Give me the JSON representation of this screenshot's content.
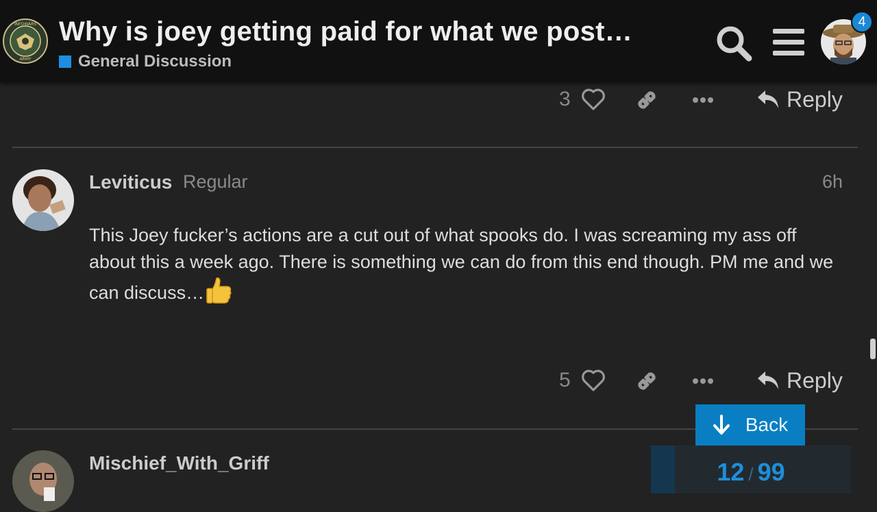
{
  "header": {
    "title": "Why is joey getting paid for what we post…",
    "category": "General Discussion",
    "category_color": "#1e8fe0",
    "logo_icon": "infowars-army-seal-icon",
    "notification_count": "4"
  },
  "posts": [
    {
      "like_count": "3",
      "reply_label": "Reply"
    },
    {
      "username": "Leviticus",
      "user_title": "Regular",
      "time": "6h",
      "body": "This Joey fucker’s actions are a cut out of what spooks do. I was screaming my ass off about this a week ago. There is something we can do from this end though. PM me and we can discuss…",
      "emoji": "thumbs-up",
      "like_count": "5",
      "reply_label": "Reply"
    },
    {
      "username": "Mischief_With_Griff"
    }
  ],
  "timeline": {
    "back_label": "Back",
    "current": "12",
    "separator": "/",
    "total": "99",
    "progress_fraction": 0.1212
  },
  "colors": {
    "accent": "#0a7ec2",
    "background": "#222222",
    "header": "#111111"
  }
}
